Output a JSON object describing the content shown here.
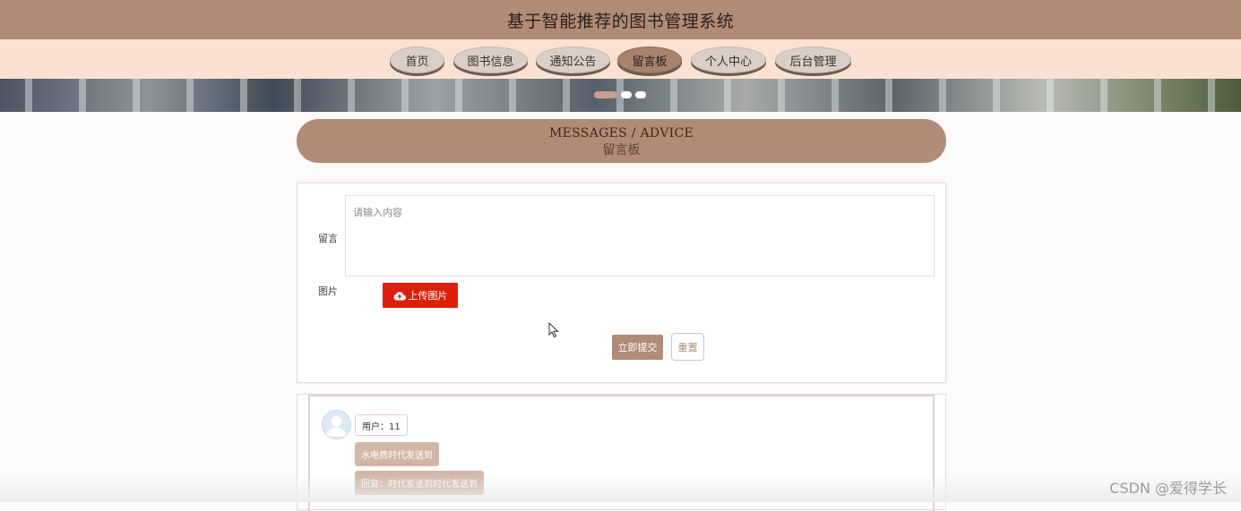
{
  "header": {
    "title": "基于智能推荐的图书管理系统"
  },
  "nav": {
    "items": [
      {
        "label": "首页"
      },
      {
        "label": "图书信息"
      },
      {
        "label": "通知公告"
      },
      {
        "label": "留言板",
        "active": true
      },
      {
        "label": "个人中心"
      },
      {
        "label": "后台管理"
      }
    ]
  },
  "banner": {
    "slides": 3,
    "active_slide": 1
  },
  "section": {
    "title_en": "MESSAGES / ADVICE",
    "title_cn": "留言板"
  },
  "form": {
    "message_label": "留言",
    "message_placeholder": "请输入内容",
    "image_label": "图片",
    "upload_label": "上传图片",
    "submit_label": "立即提交",
    "reset_label": "重置"
  },
  "messages": [
    {
      "user": "用户：11",
      "content": "水电费时代发送到",
      "reply": "回复：时代发送到时代发送到"
    }
  ],
  "watermark": "CSDN @爱得学长",
  "colors": {
    "brand": "#b08b76",
    "nav_bg": "#fbe1d2",
    "upload": "#dd1f0b"
  }
}
